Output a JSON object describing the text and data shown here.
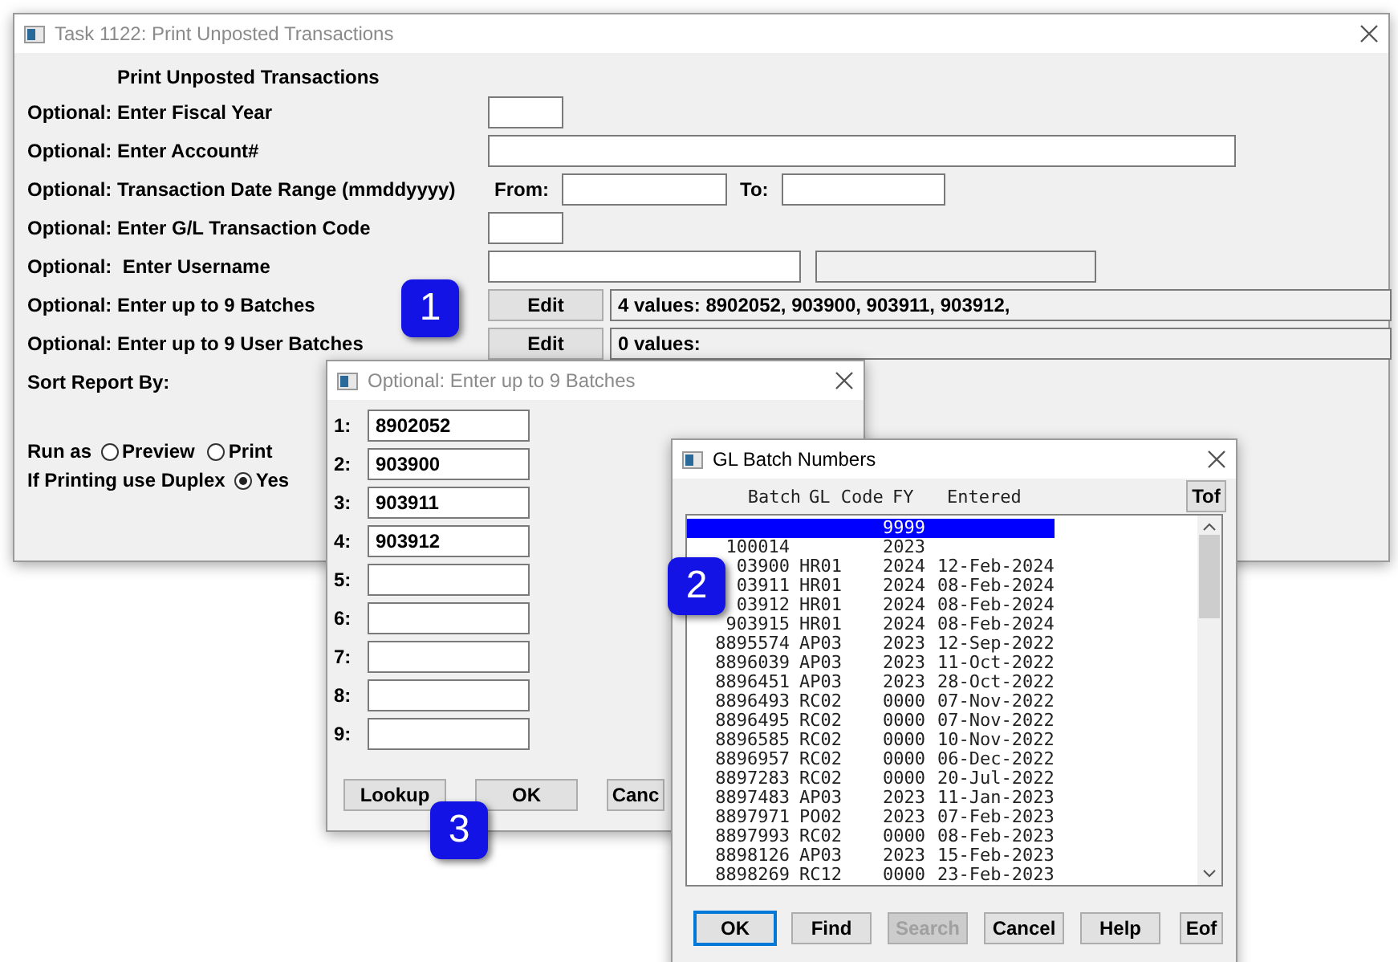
{
  "main_window": {
    "title": "Task 1122: Print Unposted Transactions",
    "heading": "Print Unposted Transactions",
    "rows": [
      {
        "kind": "short",
        "label": "Optional: Enter Fiscal Year"
      },
      {
        "kind": "long",
        "label": "Optional: Enter Account#"
      },
      {
        "kind": "range",
        "label": "Optional: Transaction Date Range (mmddyyyy)",
        "from_label": "From:",
        "to_label": "To:"
      },
      {
        "kind": "short",
        "label": "Optional: Enter G/L Transaction Code"
      },
      {
        "kind": "user",
        "label": "Optional:  Enter Username"
      },
      {
        "kind": "edit",
        "label": "Optional: Enter up to 9 Batches",
        "button": "Edit",
        "value": "4 values: 8902052, 903900, 903911, 903912,"
      },
      {
        "kind": "edit",
        "label": "Optional: Enter up to 9 User Batches",
        "button": "Edit",
        "value": "0 values:"
      },
      {
        "kind": "text",
        "label": "Sort Report By:"
      }
    ],
    "run_as": {
      "label": "Run as",
      "options": [
        {
          "label": "Preview",
          "selected": false
        },
        {
          "label": "Print",
          "selected": false
        }
      ]
    },
    "duplex": {
      "label": "If Printing use Duplex",
      "options": [
        {
          "label": "Yes",
          "selected": true
        }
      ]
    }
  },
  "batch_dialog": {
    "title": "Optional: Enter up to 9 Batches",
    "entries": [
      {
        "label": "1:",
        "value": "8902052"
      },
      {
        "label": "2:",
        "value": "903900"
      },
      {
        "label": "3:",
        "value": "903911"
      },
      {
        "label": "4:",
        "value": "903912"
      },
      {
        "label": "5:"
      },
      {
        "label": "6:"
      },
      {
        "label": "7:"
      },
      {
        "label": "8:"
      },
      {
        "label": "9:"
      }
    ],
    "buttons": [
      "Lookup",
      "OK",
      "Canc"
    ]
  },
  "gl_window": {
    "title": "GL Batch Numbers",
    "columns": [
      "Batch",
      "GL Code",
      "FY",
      "Entered"
    ],
    "top_button": "Tof",
    "rows": [
      {
        "batch": "",
        "code": "",
        "fy": "9999",
        "entered": "",
        "selected": true
      },
      {
        "batch": "100014",
        "code": "",
        "fy": "2023",
        "entered": "",
        "selected": false
      },
      {
        "batch": "03900",
        "code": "HR01",
        "fy": "2024",
        "entered": "12-Feb-2024",
        "selected": false
      },
      {
        "batch": "03911",
        "code": "HR01",
        "fy": "2024",
        "entered": "08-Feb-2024",
        "selected": false
      },
      {
        "batch": "03912",
        "code": "HR01",
        "fy": "2024",
        "entered": "08-Feb-2024",
        "selected": false
      },
      {
        "batch": "903915",
        "code": "HR01",
        "fy": "2024",
        "entered": "08-Feb-2024",
        "selected": false
      },
      {
        "batch": "8895574",
        "code": "AP03",
        "fy": "2023",
        "entered": "12-Sep-2022",
        "selected": false
      },
      {
        "batch": "8896039",
        "code": "AP03",
        "fy": "2023",
        "entered": "11-Oct-2022",
        "selected": false
      },
      {
        "batch": "8896451",
        "code": "AP03",
        "fy": "2023",
        "entered": "28-Oct-2022",
        "selected": false
      },
      {
        "batch": "8896493",
        "code": "RC02",
        "fy": "0000",
        "entered": "07-Nov-2022",
        "selected": false
      },
      {
        "batch": "8896495",
        "code": "RC02",
        "fy": "0000",
        "entered": "07-Nov-2022",
        "selected": false
      },
      {
        "batch": "8896585",
        "code": "RC02",
        "fy": "0000",
        "entered": "10-Nov-2022",
        "selected": false
      },
      {
        "batch": "8896957",
        "code": "RC02",
        "fy": "0000",
        "entered": "06-Dec-2022",
        "selected": false
      },
      {
        "batch": "8897283",
        "code": "RC02",
        "fy": "0000",
        "entered": "20-Jul-2022",
        "selected": false
      },
      {
        "batch": "8897483",
        "code": "AP03",
        "fy": "2023",
        "entered": "11-Jan-2023",
        "selected": false
      },
      {
        "batch": "8897971",
        "code": "PO02",
        "fy": "2023",
        "entered": "07-Feb-2023",
        "selected": false
      },
      {
        "batch": "8897993",
        "code": "RC02",
        "fy": "0000",
        "entered": "08-Feb-2023",
        "selected": false
      },
      {
        "batch": "8898126",
        "code": "AP03",
        "fy": "2023",
        "entered": "15-Feb-2023",
        "selected": false
      },
      {
        "batch": "8898269",
        "code": "RC12",
        "fy": "0000",
        "entered": "23-Feb-2023",
        "selected": false
      }
    ],
    "buttons": [
      {
        "label": "OK",
        "disabled": false,
        "focused": true
      },
      {
        "label": "Find",
        "disabled": false,
        "focused": false
      },
      {
        "label": "Search",
        "disabled": true,
        "focused": false
      },
      {
        "label": "Cancel",
        "disabled": false,
        "focused": false
      },
      {
        "label": "Help",
        "disabled": false,
        "focused": false
      }
    ],
    "bottom_button": "Eof"
  },
  "callouts": [
    "1",
    "2",
    "3"
  ]
}
